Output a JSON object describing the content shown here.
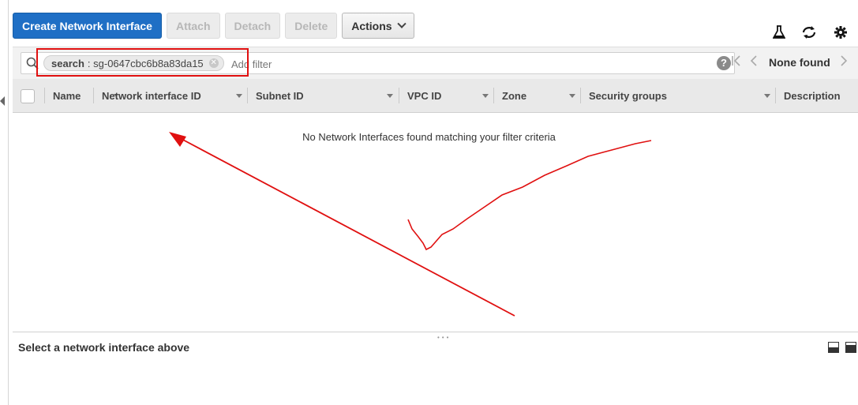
{
  "toolbar": {
    "create_label": "Create Network Interface",
    "attach_label": "Attach",
    "detach_label": "Detach",
    "delete_label": "Delete",
    "actions_label": "Actions"
  },
  "top_icons": [
    "flask-icon",
    "refresh-icon",
    "gear-icon"
  ],
  "filter": {
    "token_key": "search",
    "token_value": ": sg-0647cbc6b8a83da15",
    "placeholder": "Add filter",
    "help": "?"
  },
  "pager": {
    "first": "|‹",
    "prev": "‹",
    "label": "None found",
    "next": "›"
  },
  "columns": [
    {
      "label": "Name"
    },
    {
      "label": "Network interface ID"
    },
    {
      "label": "Subnet ID"
    },
    {
      "label": "VPC ID"
    },
    {
      "label": "Zone"
    },
    {
      "label": "Security groups"
    },
    {
      "label": "Description"
    }
  ],
  "empty_message": "No Network Interfaces found matching your filter criteria",
  "details": {
    "title": "Select a network interface above"
  },
  "colors": {
    "primary": "#1f6fc5",
    "annotation": "#e01010"
  }
}
